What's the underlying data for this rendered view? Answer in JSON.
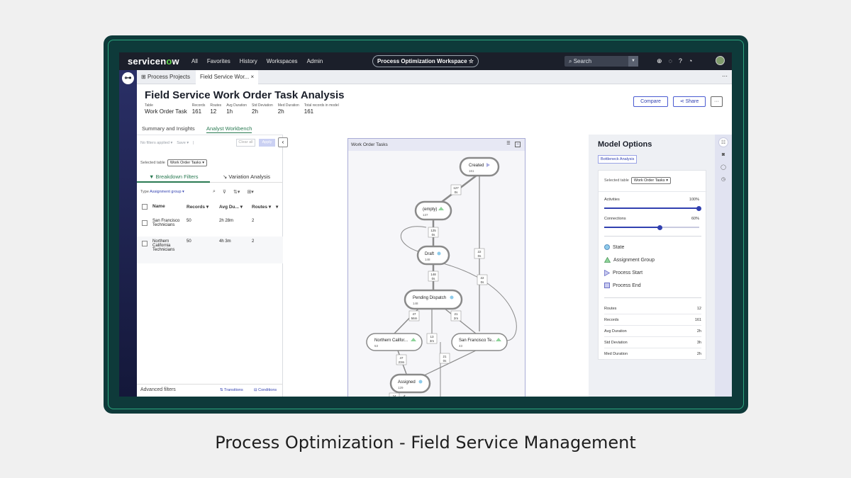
{
  "caption": "Process Optimization - Field Service Management",
  "topnav": {
    "logo_a": "servicen",
    "logo_o": "o",
    "logo_b": "w",
    "links": [
      "All",
      "Favorites",
      "History",
      "Workspaces",
      "Admin"
    ],
    "workspace": "Process Optimization Workspace ☆",
    "search_placeholder": "Search"
  },
  "tabs": {
    "t1": "Process Projects",
    "t2": "Field Service Wor...",
    "close": "×",
    "more": "···"
  },
  "header": {
    "title": "Field Service Work Order Task Analysis",
    "stats": [
      {
        "label": "Table",
        "value": "Work Order Task"
      },
      {
        "label": "Records",
        "value": "161"
      },
      {
        "label": "Routes",
        "value": "12"
      },
      {
        "label": "Avg Duration",
        "value": "1h"
      },
      {
        "label": "Std Deviation",
        "value": "2h"
      },
      {
        "label": "Med Duration",
        "value": "2h"
      },
      {
        "label": "Total records in model",
        "value": "161"
      }
    ],
    "compare": "Compare",
    "share": "Share",
    "more": "···"
  },
  "subtabs": {
    "summary": "Summary and Insights",
    "workbench": "Analyst Workbench"
  },
  "left": {
    "filters": "No filters applied ▾",
    "save": "Save ▾",
    "divider": "|",
    "clear": "Clear all",
    "apply": "Apply",
    "selected_table_label": "Selected table",
    "selected_table": "Work Order Tasks ▾",
    "tab_breakdown": "Breakdown Filters",
    "tab_variation": "Variation Analysis",
    "type_label": "Type",
    "type_value": "Assignment group ▾",
    "columns": [
      "Name",
      "Records ▾",
      "Avg Du... ▾",
      "Routes ▾",
      "▾"
    ],
    "rows": [
      {
        "name": "San Francisco Technicians",
        "records": "50",
        "avg": "2h 28m",
        "routes": "2"
      },
      {
        "name": "Northern California Technicians",
        "records": "50",
        "avg": "4h 3m",
        "routes": "2"
      }
    ],
    "advanced": "Advanced filters",
    "transitions": "Transitions",
    "conditions": "Conditions"
  },
  "flow": {
    "title": "Work Order Tasks",
    "nodes": {
      "created": {
        "name": "Created",
        "count": "161"
      },
      "empty": {
        "name": "(empty)",
        "count": "137"
      },
      "draft": {
        "name": "Draft",
        "count": "148"
      },
      "pending": {
        "name": "Pending Dispatch",
        "count": "148"
      },
      "norcal": {
        "name": "Northern Califor...",
        "count": "53"
      },
      "sf": {
        "name": "San Francisco Te...",
        "count": "43"
      },
      "assigned": {
        "name": "Assigned",
        "count": "129"
      }
    },
    "edges": [
      {
        "a": "127",
        "b": "0s"
      },
      {
        "a": "125",
        "b": "0s"
      },
      {
        "a": "22",
        "b": "0s"
      },
      {
        "a": "148",
        "b": "0s"
      },
      {
        "a": "22",
        "b": "0s"
      },
      {
        "a": "47",
        "b": "56m"
      },
      {
        "a": "21",
        "b": "2m"
      },
      {
        "a": "13",
        "b": "3m"
      },
      {
        "a": "47",
        "b": "23m"
      },
      {
        "a": "21",
        "b": "0s"
      },
      {
        "a": "24",
        "b": ""
      }
    ]
  },
  "model": {
    "title": "Model Options",
    "badge": "Bottleneck Analysis",
    "selected_table_label": "Selected table",
    "selected_table": "Work Order Tasks ▾",
    "activities": "Activities",
    "activities_pct": "100%",
    "activities_value": 1.0,
    "connections": "Connections",
    "connections_pct": "60%",
    "connections_value": 0.6,
    "legend": [
      {
        "label": "State",
        "shape": "circle",
        "color": "#8ecbea"
      },
      {
        "label": "Assignment Group",
        "shape": "triangle",
        "color": "#8ed49a"
      },
      {
        "label": "Process Start",
        "shape": "play",
        "color": "#a7abe0"
      },
      {
        "label": "Process End",
        "shape": "square",
        "color": "#c9cbef"
      }
    ],
    "metrics": [
      {
        "label": "Routes",
        "value": "12"
      },
      {
        "label": "Records",
        "value": "161"
      },
      {
        "label": "Avg Duration",
        "value": "2h"
      },
      {
        "label": "Std Deviation",
        "value": "3h"
      },
      {
        "label": "Med Duration",
        "value": "2h"
      }
    ]
  },
  "colors": {
    "brand_green": "#62d84e",
    "accent": "#3140b0",
    "workbench_green": "#2a7a52"
  }
}
